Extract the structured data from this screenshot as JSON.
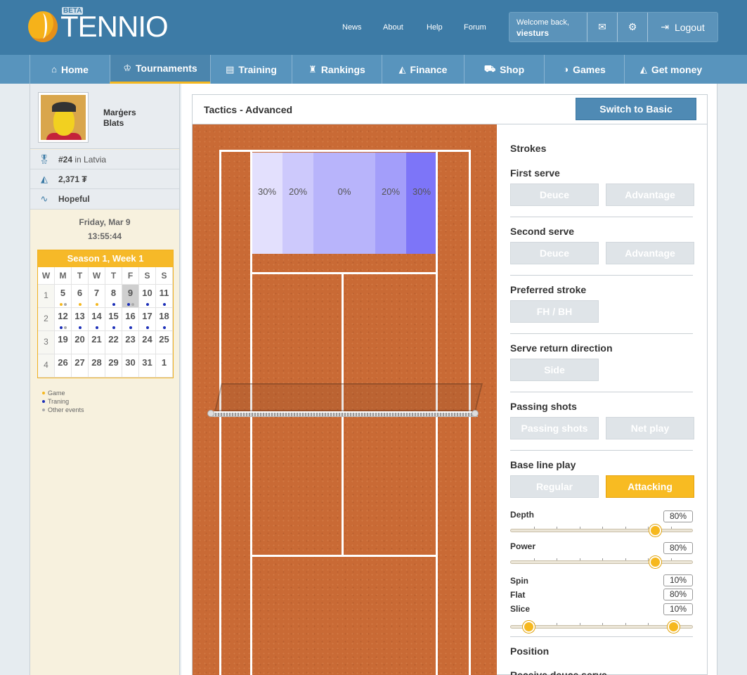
{
  "brand": {
    "name": "TENNIO",
    "badge": "BETA"
  },
  "toplinks": [
    "News",
    "About",
    "Help",
    "Forum"
  ],
  "user": {
    "welcome": "Welcome back,",
    "username": "viesturs",
    "logout": "Logout"
  },
  "nav": [
    {
      "label": "Home",
      "icon": "home-icon",
      "active": false
    },
    {
      "label": "Tournaments",
      "icon": "trophy-icon",
      "active": true
    },
    {
      "label": "Training",
      "icon": "calendar-icon",
      "active": false
    },
    {
      "label": "Rankings",
      "icon": "medal-icon",
      "active": false
    },
    {
      "label": "Finance",
      "icon": "money-icon",
      "active": false
    },
    {
      "label": "Shop",
      "icon": "cart-icon",
      "active": false
    },
    {
      "label": "Games",
      "icon": "ball-icon",
      "active": false
    },
    {
      "label": "Get money",
      "icon": "money-bag-icon",
      "active": false
    }
  ],
  "profile": {
    "first": "Marģers",
    "last": "Blats",
    "rank": "#24",
    "rank_suffix": "in Latvia",
    "money": "2,371 ₮",
    "status": "Hopeful"
  },
  "datetime": {
    "date": "Friday, Mar 9",
    "time": "13:55:44"
  },
  "calendar": {
    "title": "Season 1, Week 1",
    "headers": [
      "W",
      "M",
      "T",
      "W",
      "T",
      "F",
      "S",
      "S"
    ],
    "weeks": [
      {
        "w": "1",
        "days": [
          {
            "d": "5",
            "dots": [
              "game",
              "other"
            ]
          },
          {
            "d": "6",
            "dots": [
              "game"
            ]
          },
          {
            "d": "7",
            "dots": [
              "game"
            ]
          },
          {
            "d": "8",
            "dots": [
              "train"
            ]
          },
          {
            "d": "9",
            "dots": [
              "train",
              "other"
            ],
            "today": true
          },
          {
            "d": "10",
            "dots": [
              "train"
            ]
          },
          {
            "d": "11",
            "dots": [
              "train"
            ]
          }
        ]
      },
      {
        "w": "2",
        "days": [
          {
            "d": "12",
            "dots": [
              "train",
              "other"
            ]
          },
          {
            "d": "13",
            "dots": [
              "train"
            ]
          },
          {
            "d": "14",
            "dots": [
              "train"
            ]
          },
          {
            "d": "15",
            "dots": [
              "train"
            ]
          },
          {
            "d": "16",
            "dots": [
              "train"
            ]
          },
          {
            "d": "17",
            "dots": [
              "train"
            ]
          },
          {
            "d": "18",
            "dots": [
              "train"
            ]
          }
        ]
      },
      {
        "w": "3",
        "days": [
          {
            "d": "19"
          },
          {
            "d": "20"
          },
          {
            "d": "21"
          },
          {
            "d": "22"
          },
          {
            "d": "23"
          },
          {
            "d": "24"
          },
          {
            "d": "25"
          }
        ]
      },
      {
        "w": "4",
        "days": [
          {
            "d": "26"
          },
          {
            "d": "27"
          },
          {
            "d": "28"
          },
          {
            "d": "29"
          },
          {
            "d": "30"
          },
          {
            "d": "31"
          },
          {
            "d": "1"
          }
        ]
      }
    ],
    "legend": [
      {
        "label": "Game",
        "type": "game"
      },
      {
        "label": "Traning",
        "type": "train"
      },
      {
        "label": "Other events",
        "type": "other"
      }
    ]
  },
  "colors": {
    "game": "#f5b821",
    "train": "#1c2fb8",
    "other": "#aaaaaa"
  },
  "panel": {
    "title": "Tactics - Advanced",
    "switch_label": "Switch to Basic"
  },
  "zones": [
    {
      "label": "30%",
      "color": "#e3e0fd"
    },
    {
      "label": "20%",
      "color": "#cdc9fc"
    },
    {
      "label": "0%",
      "color": "#b8b4fb"
    },
    {
      "label": "20%",
      "color": "#a39efa"
    },
    {
      "label": "30%",
      "color": "#7d75f8"
    }
  ],
  "options": {
    "strokes": "Strokes",
    "first_serve": {
      "title": "First serve",
      "a": "Deuce",
      "b": "Advantage"
    },
    "second_serve": {
      "title": "Second serve",
      "a": "Deuce",
      "b": "Advantage"
    },
    "preferred": {
      "title": "Preferred stroke",
      "a": "FH / BH"
    },
    "return_dir": {
      "title": "Serve return direction",
      "a": "Side"
    },
    "passing": {
      "title": "Passing shots",
      "a": "Passing shots",
      "b": "Net play"
    },
    "baseline": {
      "title": "Base line play",
      "a": "Regular",
      "b": "Attacking",
      "selected": "b"
    },
    "depth": {
      "label": "Depth",
      "value": "80%",
      "level": 0.8
    },
    "power": {
      "label": "Power",
      "value": "80%",
      "level": 0.8
    },
    "spin": {
      "label": "Spin",
      "value": "10%"
    },
    "flat": {
      "label": "Flat",
      "value": "80%"
    },
    "slice": {
      "label": "Slice",
      "value": "10%"
    },
    "spin_split": {
      "low": 0.1,
      "high": 0.9
    },
    "position": "Position",
    "receive": "Receive deuce serve"
  }
}
